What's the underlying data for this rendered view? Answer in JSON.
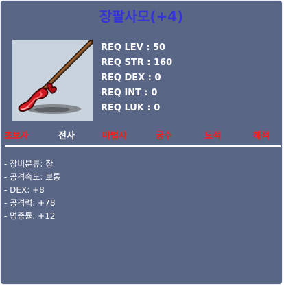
{
  "item": {
    "name": "장팔사모(+4)",
    "icon": "spear-icon"
  },
  "requirements": [
    {
      "label": "REQ LEV",
      "value": "50"
    },
    {
      "label": "REQ STR",
      "value": "160"
    },
    {
      "label": "REQ DEX",
      "value": "0"
    },
    {
      "label": "REQ INT",
      "value": "0"
    },
    {
      "label": "REQ LUK",
      "value": "0"
    }
  ],
  "jobs": [
    {
      "label": "초보자",
      "allowed": false
    },
    {
      "label": "전사",
      "allowed": true
    },
    {
      "label": "마법사",
      "allowed": false
    },
    {
      "label": "궁수",
      "allowed": false
    },
    {
      "label": "도적",
      "allowed": false
    },
    {
      "label": "해적",
      "allowed": false
    }
  ],
  "colors": {
    "title": "#3433d7",
    "allowed": "#ffffff",
    "disallowed": "#ff1a1a",
    "panel": "#5a6685"
  },
  "stats": [
    {
      "label": "장비분류",
      "value": "창"
    },
    {
      "label": "공격속도",
      "value": "보통"
    },
    {
      "label": "DEX",
      "value": "+8"
    },
    {
      "label": "공격력",
      "value": "+78"
    },
    {
      "label": "명중률",
      "value": "+12"
    }
  ]
}
